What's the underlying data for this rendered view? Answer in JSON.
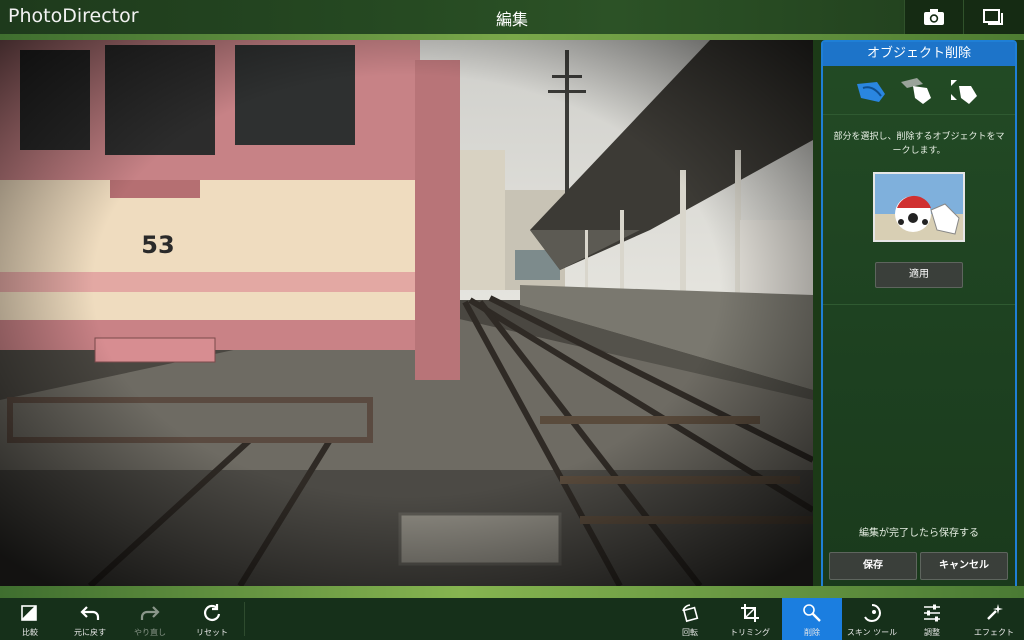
{
  "app": {
    "name": "PhotoDirector",
    "page_title": "編集"
  },
  "topbar": {
    "camera_icon": "camera-icon",
    "window_icon": "window-icon"
  },
  "photo": {
    "tram_number": "53"
  },
  "panel": {
    "title": "オブジェクト削除",
    "tools": [
      "mark-object-icon",
      "erase-mark-icon",
      "resize-brush-icon"
    ],
    "description": "部分を選択し、削除するオブジェクトをマークします。",
    "apply_label": "適用",
    "save_hint": "編集が完了したら保存する",
    "save_label": "保存",
    "cancel_label": "キャンセル",
    "accent": "#1d74c9"
  },
  "bottom_toolbar": {
    "left": [
      {
        "label": "比較",
        "icon": "compare-icon",
        "enabled": true
      },
      {
        "label": "元に戻す",
        "icon": "undo-icon",
        "enabled": true
      },
      {
        "label": "やり直し",
        "icon": "redo-icon",
        "enabled": false
      },
      {
        "label": "リセット",
        "icon": "reset-icon",
        "enabled": true
      }
    ],
    "right": [
      {
        "label": "回転",
        "icon": "rotate-icon",
        "active": false
      },
      {
        "label": "トリミング",
        "icon": "crop-icon",
        "active": false
      },
      {
        "label": "削除",
        "icon": "remove-icon",
        "active": true
      },
      {
        "label": "スキン ツール",
        "icon": "skin-tool-icon",
        "active": false
      },
      {
        "label": "調整",
        "icon": "adjust-icon",
        "active": false
      },
      {
        "label": "エフェクト",
        "icon": "effect-icon",
        "active": false
      }
    ]
  }
}
